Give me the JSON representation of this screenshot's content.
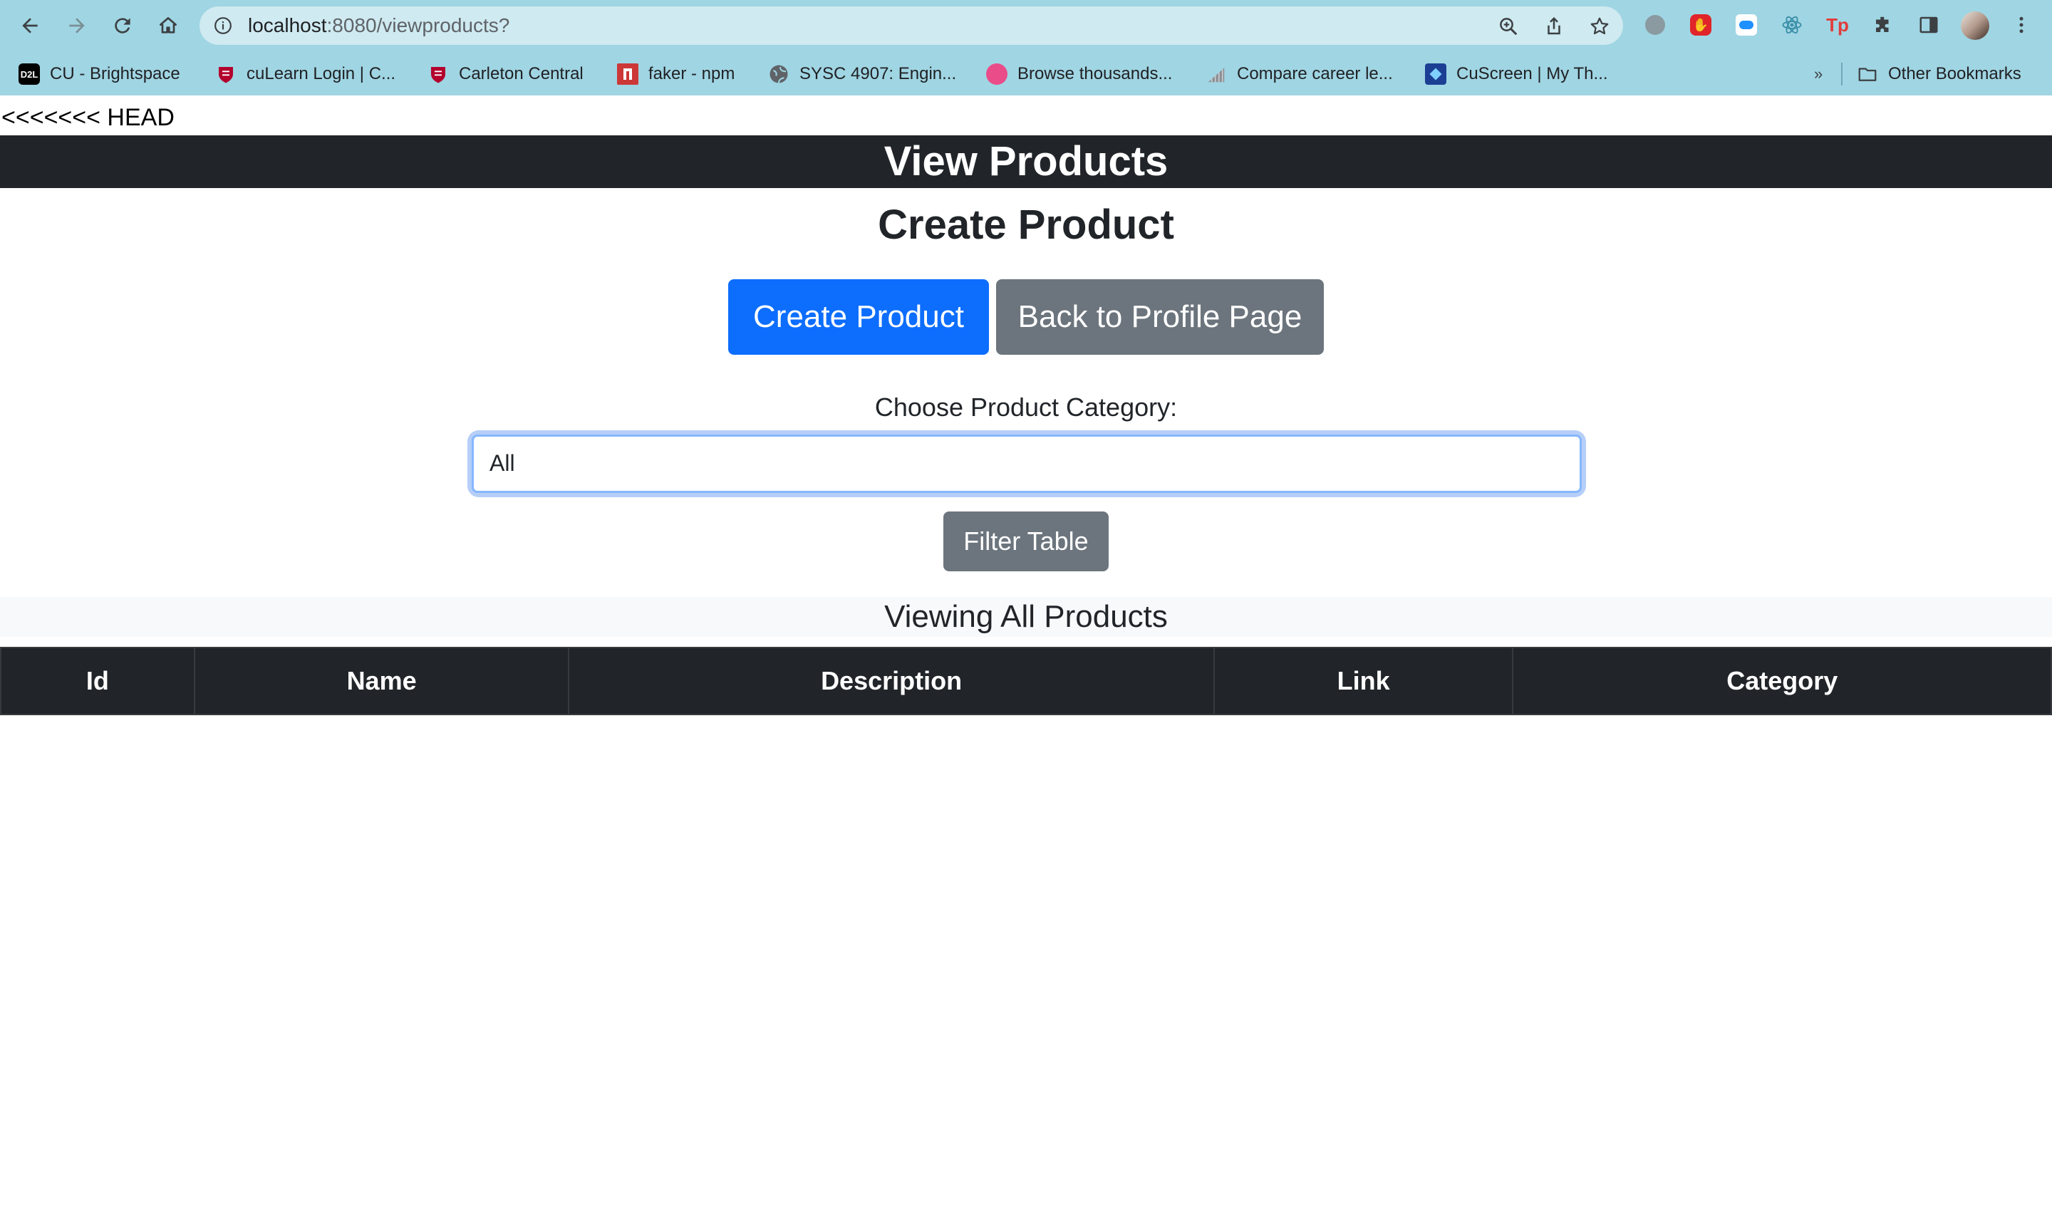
{
  "browser": {
    "url_host": "localhost",
    "url_rest": ":8080/viewproducts?",
    "bookmarks": [
      {
        "label": "CU - Brightspace",
        "favicon": "d2l-icon",
        "color": "#000000"
      },
      {
        "label": "cuLearn Login | C...",
        "favicon": "carleton-shield-icon",
        "color": "#b3002d"
      },
      {
        "label": "Carleton Central",
        "favicon": "carleton-shield-icon",
        "color": "#b3002d"
      },
      {
        "label": "faker - npm",
        "favicon": "npm-icon",
        "color": "#cb3837"
      },
      {
        "label": "SYSC 4907: Engin...",
        "favicon": "globe-icon",
        "color": "#5f6368"
      },
      {
        "label": "Browse thousands...",
        "favicon": "dribbble-icon",
        "color": "#ea4c89"
      },
      {
        "label": "Compare career le...",
        "favicon": "chart-icon",
        "color": "#8a8f94"
      },
      {
        "label": "CuScreen | My Th...",
        "favicon": "cuscreen-icon",
        "color": "#1c3f94"
      }
    ],
    "overflow_label": "»",
    "other_bookmarks": "Other Bookmarks"
  },
  "page": {
    "head_marker": "<<<<<<< HEAD",
    "title": "View Products",
    "section_title": "Create Product",
    "create_button": "Create Product",
    "back_button": "Back to Profile Page",
    "filter_label": "Choose Product Category:",
    "category_selected": "All",
    "filter_button": "Filter Table",
    "viewing_heading": "Viewing All Products",
    "table_headers": [
      "Id",
      "Name",
      "Description",
      "Link",
      "Category"
    ]
  },
  "colors": {
    "chrome": "#a0d5e3",
    "navbar": "#212529",
    "primary": "#0d6efd",
    "secondary": "#6c757d"
  }
}
